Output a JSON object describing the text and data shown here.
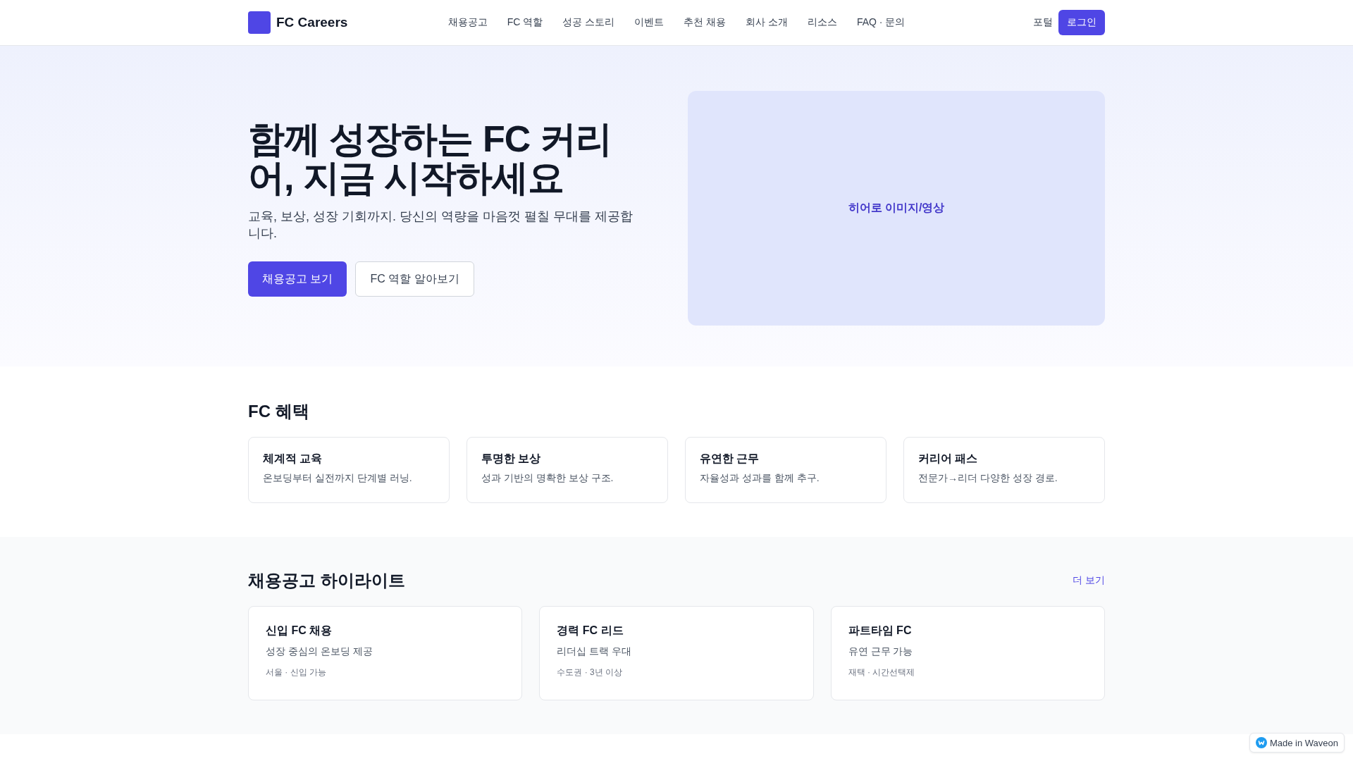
{
  "header": {
    "logo": "FC Careers",
    "nav": [
      {
        "label": "채용공고"
      },
      {
        "label": "FC 역할"
      },
      {
        "label": "성공 스토리"
      },
      {
        "label": "이벤트"
      },
      {
        "label": "추천 채용"
      },
      {
        "label": "회사 소개"
      },
      {
        "label": "리소스"
      },
      {
        "label": "FAQ · 문의"
      }
    ],
    "portal": "포털",
    "login": "로그인"
  },
  "hero": {
    "title": "함께 성장하는 FC 커리어, 지금 시작하세요",
    "subtitle": "교육, 보상, 성장 기회까지. 당신의 역량을 마음껏 펼칠 무대를 제공합니다.",
    "primary_button": "채용공고 보기",
    "secondary_button": "FC 역할 알아보기",
    "media_placeholder": "히어로 이미지/영상"
  },
  "benefits": {
    "title": "FC 혜택",
    "cards": [
      {
        "title": "체계적 교육",
        "text": "온보딩부터 실전까지 단계별 러닝."
      },
      {
        "title": "투명한 보상",
        "text": "성과 기반의 명확한 보상 구조."
      },
      {
        "title": "유연한 근무",
        "text": "자율성과 성과를 함께 추구."
      },
      {
        "title": "커리어 패스",
        "text": "전문가→리더 다양한 성장 경로."
      }
    ]
  },
  "jobs": {
    "title": "채용공고 하이라이트",
    "more": "더 보기",
    "cards": [
      {
        "title": "신입 FC 채용",
        "text": "성장 중심의 온보딩 제공",
        "meta": "서울 · 신입 가능"
      },
      {
        "title": "경력 FC 리드",
        "text": "리더십 트랙 우대",
        "meta": "수도권 · 3년 이상"
      },
      {
        "title": "파트타임 FC",
        "text": "유연 근무 가능",
        "meta": "재택 · 시간선택제"
      }
    ]
  },
  "badge": "Made in Waveon"
}
